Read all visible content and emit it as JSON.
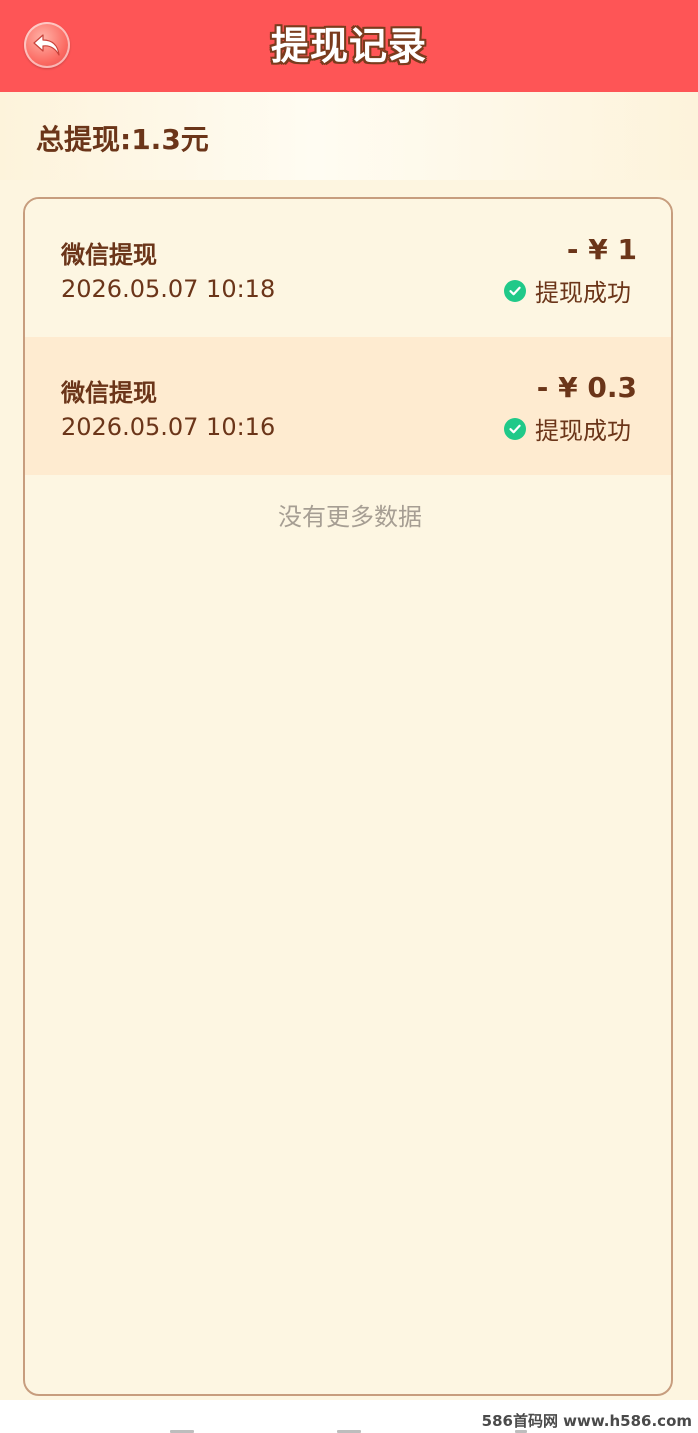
{
  "header": {
    "title": "提现记录",
    "back_icon": "back-arrow-icon"
  },
  "summary": {
    "total_text": "总提现:1.3元"
  },
  "records": [
    {
      "title": "微信提现",
      "time": "2026.05.07 10:18",
      "amount": "- ¥ 1",
      "status": "提现成功",
      "status_icon": "check-circle-icon"
    },
    {
      "title": "微信提现",
      "time": "2026.05.07 10:16",
      "amount": "- ¥ 0.3",
      "status": "提现成功",
      "status_icon": "check-circle-icon"
    }
  ],
  "list_footer": "没有更多数据",
  "watermark": "586首码网 www.h586.com",
  "colors": {
    "header_bg": "#fe5556",
    "page_bg": "#fdf5e0",
    "text_brown": "#6b3519",
    "success_green": "#20c989",
    "highlight_row": "#feebd0"
  }
}
